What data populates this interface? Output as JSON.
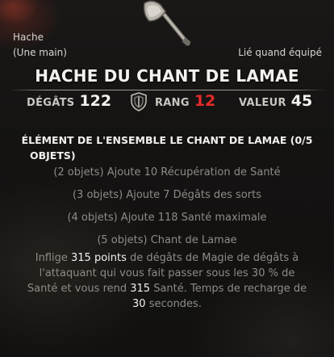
{
  "item": {
    "type": "Hache",
    "hand": "(Une main)",
    "binding": "Lié quand équipé",
    "name": "HACHE DU CHANT DE LAMAE",
    "icon": "axe-icon"
  },
  "stats": {
    "damage_label": "DÉGÂTS",
    "damage_value": "122",
    "rank_icon": "shield-icon",
    "rank_label": "RANG",
    "rank_value": "12",
    "value_label": "VALEUR",
    "value_value": "45"
  },
  "set": {
    "header_line1": "ÉLÉMENT DE L'ENSEMBLE LE CHANT DE LAMAE (0/5",
    "header_line2": "OBJETS)",
    "bonuses": [
      {
        "text": "(2 objets) Ajoute 10 Récupération de Santé"
      },
      {
        "text": "(3 objets) Ajoute 7 Dégâts des sorts"
      },
      {
        "text": "(4 objets) Ajoute 118 Santé maximale"
      },
      {
        "text": "(5 objets) Chant de Lamae"
      }
    ],
    "five_piece": {
      "p1": "Inflige ",
      "n1": "315 points",
      "p2": " de dégâts de Magie de dégâts à",
      "p3": "l'attaquant qui vous fait passer sous les 30 % de",
      "p4": "Santé et vous rend ",
      "n2": "315",
      "p5": " Santé. Temps de recharge de",
      "n3": "30",
      "p6": " secondes."
    }
  },
  "colors": {
    "rank_red": "#e52a2a",
    "title_white": "#f4f2ee",
    "bonus_grey": "#8f8b85"
  }
}
